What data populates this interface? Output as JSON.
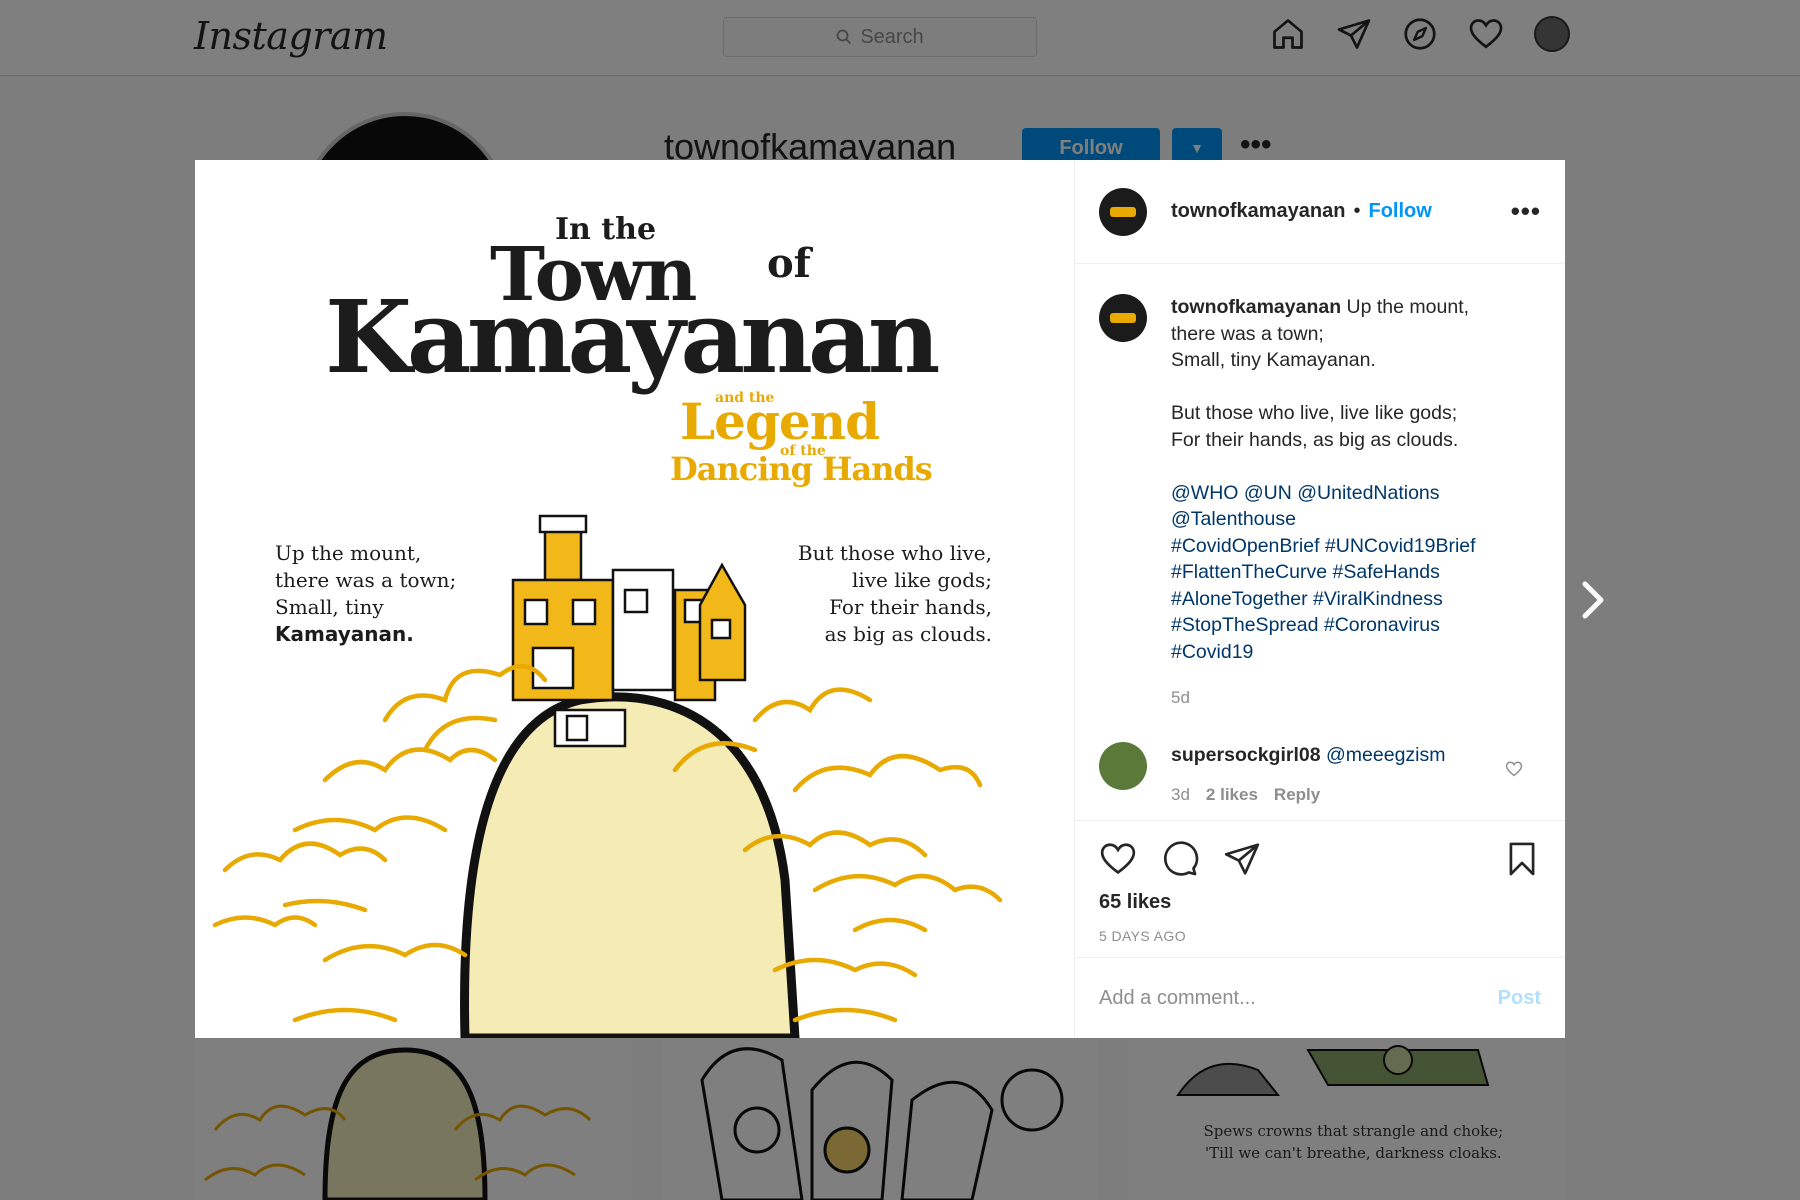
{
  "topnav": {
    "logo": "Instagram",
    "search_placeholder": "Search",
    "icons": [
      "home-icon",
      "direct-icon",
      "explore-icon",
      "activity-heart-icon",
      "profile-avatar"
    ]
  },
  "profile": {
    "username": "townofkamayanan",
    "follow_label": "Follow",
    "more": "•••"
  },
  "background_tile": {
    "caption_line1": "Spews crowns that strangle and choke;",
    "caption_line2": "'Till we can't breathe, darkness cloaks."
  },
  "post_image": {
    "title_line1": "In the",
    "title_town": "Town",
    "title_of": "of",
    "title_kamayanan": "Kamayanan",
    "sub_and_the": "and the",
    "sub_legend": "Legend",
    "sub_of_the": "of the",
    "sub_dancing": "Dancing Hands",
    "left_verse": [
      "Up the mount,",
      "there was a town;",
      "Small, tiny"
    ],
    "left_verse_bold": "Kamayanan.",
    "right_verse": [
      "But those who live,",
      "live like gods;",
      "For their hands,",
      "as big as clouds."
    ]
  },
  "post_header": {
    "username": "townofkamayanan",
    "dot": "•",
    "follow_label": "Follow",
    "more": "•••"
  },
  "caption": {
    "username": "townofkamayanan",
    "lines": [
      "Up the mount,",
      "there was a town;",
      "Small, tiny Kamayanan.",
      "",
      "But those who live, live like gods;",
      "For their hands, as big as clouds."
    ],
    "tag_lines": [
      "@WHO @UN @UnitedNations",
      "@Talenthouse",
      "#CovidOpenBrief #UNCovid19Brief",
      "#FlattenTheCurve #SafeHands",
      "#AloneTogether #ViralKindness",
      "#StopTheSpread #Coronavirus",
      "#Covid19"
    ],
    "time": "5d"
  },
  "comment": {
    "username": "supersockgirl08",
    "mention": "@meeegzism",
    "time": "3d",
    "likes": "2 likes",
    "reply": "Reply"
  },
  "actions": {
    "likes": "65 likes",
    "posted_ago": "5 DAYS AGO"
  },
  "add_comment": {
    "placeholder": "Add a comment...",
    "post_label": "Post"
  },
  "colors": {
    "accent_blue": "#0095f6",
    "tag_blue": "#00376b",
    "art_yellow": "#e8a900"
  }
}
